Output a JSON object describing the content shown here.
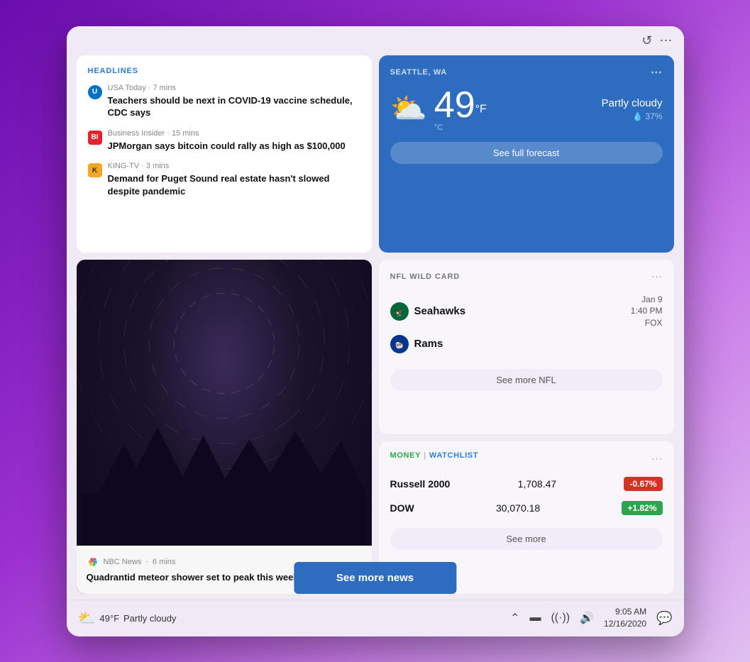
{
  "device": {
    "top_icons": {
      "refresh_label": "↺",
      "more_label": "⋯"
    }
  },
  "headlines": {
    "title": "HEADLINES",
    "items": [
      {
        "source": "USA Today",
        "time": "7 mins",
        "headline": "Teachers should be next in COVID-19 vaccine schedule, CDC says",
        "icon_type": "usa-today"
      },
      {
        "source": "Business Insider",
        "time": "15 mins",
        "headline": "JPMorgan says bitcoin could rally as high as $100,000",
        "icon_type": "bi"
      },
      {
        "source": "KING-TV",
        "time": "3 mins",
        "headline": "Demand for Puget Sound real estate hasn't slowed despite pandemic",
        "icon_type": "king"
      }
    ]
  },
  "weather": {
    "location": "SEATTLE, WA",
    "temperature": "49",
    "unit_f": "°F",
    "unit_c": "°C",
    "description": "Partly cloudy",
    "humidity": "37%",
    "humidity_icon": "💧",
    "forecast_btn": "See full forecast",
    "more_icon": "⋯"
  },
  "nfl": {
    "title": "NFL WILD CARD",
    "team1": "Seahawks",
    "team2": "Rams",
    "date": "Jan 9",
    "time": "1:40 PM",
    "channel": "FOX",
    "more_btn": "See more NFL",
    "more_icon": "⋯"
  },
  "photo_news": {
    "source": "NBC News",
    "time": "6 mins",
    "headline": "Quadrantid meteor shower set to peak this weekend"
  },
  "money": {
    "title_left": "MONEY",
    "title_pipe": "|",
    "title_right": "WATCHLIST",
    "stocks": [
      {
        "name": "Russell 2000",
        "value": "1,708.47",
        "change": "-0.67%",
        "positive": false
      },
      {
        "name": "DOW",
        "value": "30,070.18",
        "change": "+1.82%",
        "positive": true
      }
    ],
    "more_btn": "See more",
    "more_icon": "⋯"
  },
  "see_more_news": "See more news",
  "taskbar": {
    "weather_icon": "⛅",
    "temp": "49°F",
    "condition": "Partly cloudy",
    "chevron": "⌃",
    "battery_icon": "🔋",
    "wifi_icon": "📶",
    "volume_icon": "🔊",
    "time": "9:05 AM",
    "date": "12/16/2020",
    "notif_icon": "💬"
  }
}
